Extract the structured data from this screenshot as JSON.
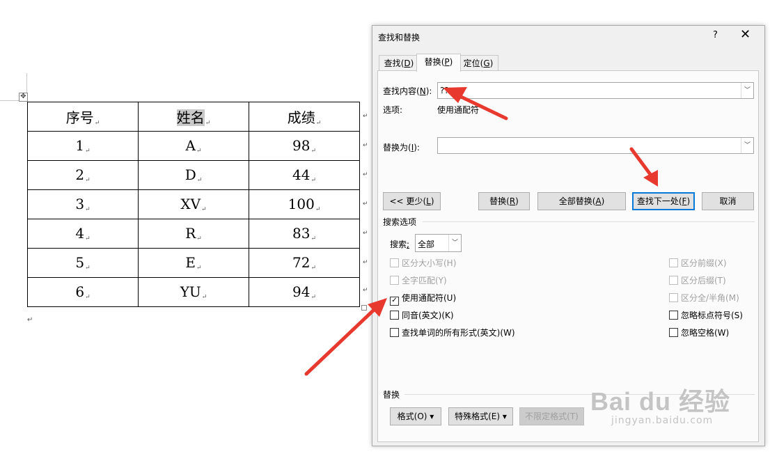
{
  "document": {
    "table": {
      "headers": [
        "序号",
        "姓名",
        "成绩"
      ],
      "rows": [
        [
          "1",
          "A",
          "98"
        ],
        [
          "2",
          "D",
          "44"
        ],
        [
          "3",
          "XV",
          "100"
        ],
        [
          "4",
          "R",
          "83"
        ],
        [
          "5",
          "E",
          "72"
        ],
        [
          "6",
          "YU",
          "94"
        ]
      ]
    },
    "mark": "↵",
    "move_handle": "✥"
  },
  "dialog": {
    "title": "查找和替换",
    "help": "?",
    "close": "✕",
    "tabs": [
      {
        "label": "查找",
        "key": "D"
      },
      {
        "label": "替换",
        "key": "P"
      },
      {
        "label": "定位",
        "key": "G"
      }
    ],
    "find_label": "查找内容",
    "find_key": "N",
    "find_value": "??",
    "options_label": "选项:",
    "options_value": "使用通配符",
    "replace_label": "替换为",
    "replace_key": "I",
    "replace_value": "",
    "buttons": {
      "less": "<< 更少",
      "less_key": "L",
      "replace": "替换",
      "replace_key": "R",
      "replace_all": "全部替换",
      "replace_all_key": "A",
      "find_next": "查找下一处",
      "find_next_key": "F",
      "cancel": "取消"
    },
    "search_options_label": "搜索选项",
    "search_label": "搜索",
    "search_key": ";",
    "search_value": "全部",
    "checkboxes_left": [
      {
        "label": "区分大小写(H)",
        "checked": false,
        "enabled": false
      },
      {
        "label": "全字匹配(Y)",
        "checked": false,
        "enabled": false
      },
      {
        "label": "使用通配符(U)",
        "checked": true,
        "enabled": true
      },
      {
        "label": "同音(英文)(K)",
        "checked": false,
        "enabled": true
      },
      {
        "label": "查找单词的所有形式(英文)(W)",
        "checked": false,
        "enabled": true
      }
    ],
    "checkboxes_right": [
      {
        "label": "区分前缀(X)",
        "checked": false,
        "enabled": false
      },
      {
        "label": "区分后缀(T)",
        "checked": false,
        "enabled": false
      },
      {
        "label": "区分全/半角(M)",
        "checked": false,
        "enabled": false
      },
      {
        "label": "忽略标点符号(S)",
        "checked": false,
        "enabled": true
      },
      {
        "label": "忽略空格(W)",
        "checked": false,
        "enabled": true
      }
    ],
    "replace_section_label": "替换",
    "format_button": "格式(O)",
    "special_button": "特殊格式(E)",
    "no_format_button": "不限定格式(T)",
    "dropdown_arrow": "▾",
    "combo_arrow": "﹀"
  },
  "watermark": {
    "line1": "Bai du 经验",
    "line2": "jingyan.baidu.com"
  },
  "colors": {
    "arrow": "#e8392f",
    "focus": "#0078d7"
  }
}
